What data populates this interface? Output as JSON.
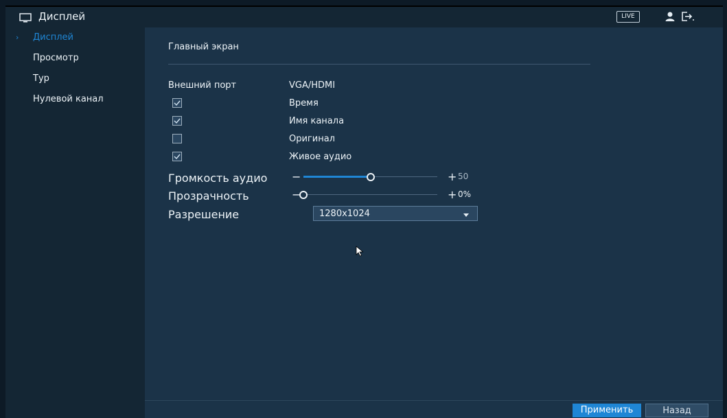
{
  "header": {
    "title": "Дисплей",
    "live_badge": "LIVE"
  },
  "sidebar": {
    "items": [
      {
        "label": "Дисплей",
        "active": true
      },
      {
        "label": "Просмотр",
        "active": false
      },
      {
        "label": "Тур",
        "active": false
      },
      {
        "label": "Нулевой канал",
        "active": false
      }
    ]
  },
  "main": {
    "section_title": "Главный экран",
    "output_port": {
      "label": "Внешний порт",
      "value": "VGA/HDMI"
    },
    "checkboxes": [
      {
        "label": "Время",
        "checked": true
      },
      {
        "label": "Имя канала",
        "checked": true
      },
      {
        "label": "Оригинал",
        "checked": false
      },
      {
        "label": "Живое аудио",
        "checked": true
      }
    ],
    "volume": {
      "label": "Громкость аудио",
      "value": "50",
      "level": 0.5
    },
    "transparency": {
      "label": "Прозрачность",
      "value": "0%",
      "level": 0.0
    },
    "resolution": {
      "label": "Разрешение",
      "value": "1280x1024"
    }
  },
  "footer": {
    "apply_label": "Применить",
    "back_label": "Назад"
  },
  "colors": {
    "accent": "#1f86d5",
    "panel": "#1b3348",
    "sidebar": "#142634"
  }
}
